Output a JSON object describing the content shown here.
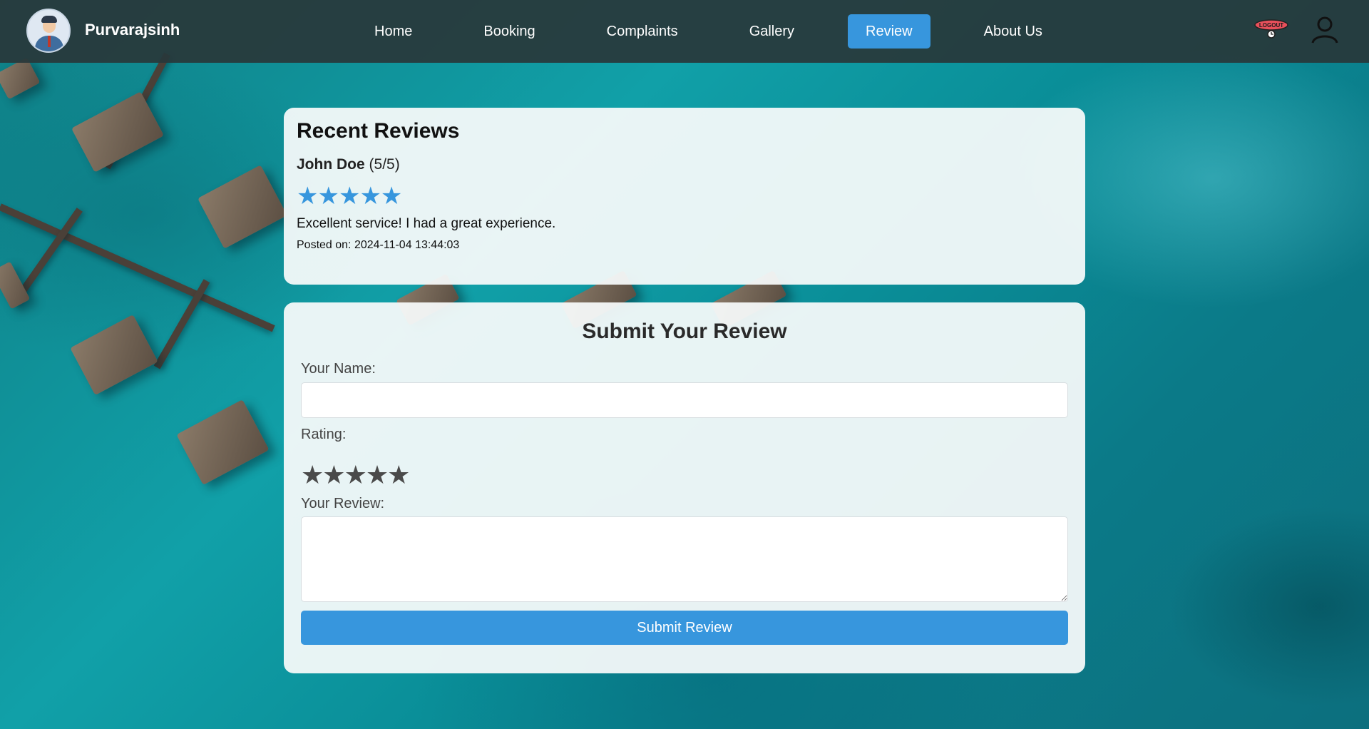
{
  "nav": {
    "username": "Purvarajsinh",
    "links": [
      {
        "label": "Home"
      },
      {
        "label": "Booking"
      },
      {
        "label": "Complaints"
      },
      {
        "label": "Gallery"
      },
      {
        "label": "Review",
        "active": true
      },
      {
        "label": "About Us"
      }
    ],
    "logout_icon_text": "LOGOUT",
    "icons": {
      "logout": "logout-icon",
      "user": "user-icon"
    }
  },
  "recent_reviews": {
    "title": "Recent Reviews",
    "items": [
      {
        "name": "John Doe",
        "rating_text": "(5/5)",
        "rating": 5,
        "stars": "★★★★★",
        "text": "Excellent service! I had a great experience.",
        "posted": "Posted on: 2024-11-04 13:44:03"
      }
    ]
  },
  "form": {
    "title": "Submit Your Review",
    "name_label": "Your Name:",
    "name_value": "",
    "rating_label": "Rating:",
    "rating_star": "★",
    "rating_max": 5,
    "review_label": "Your Review:",
    "review_value": "",
    "submit_label": "Submit Review"
  },
  "colors": {
    "accent": "#3796dd",
    "nav_bg": "#28383a",
    "star_empty": "#4a4a4a"
  }
}
